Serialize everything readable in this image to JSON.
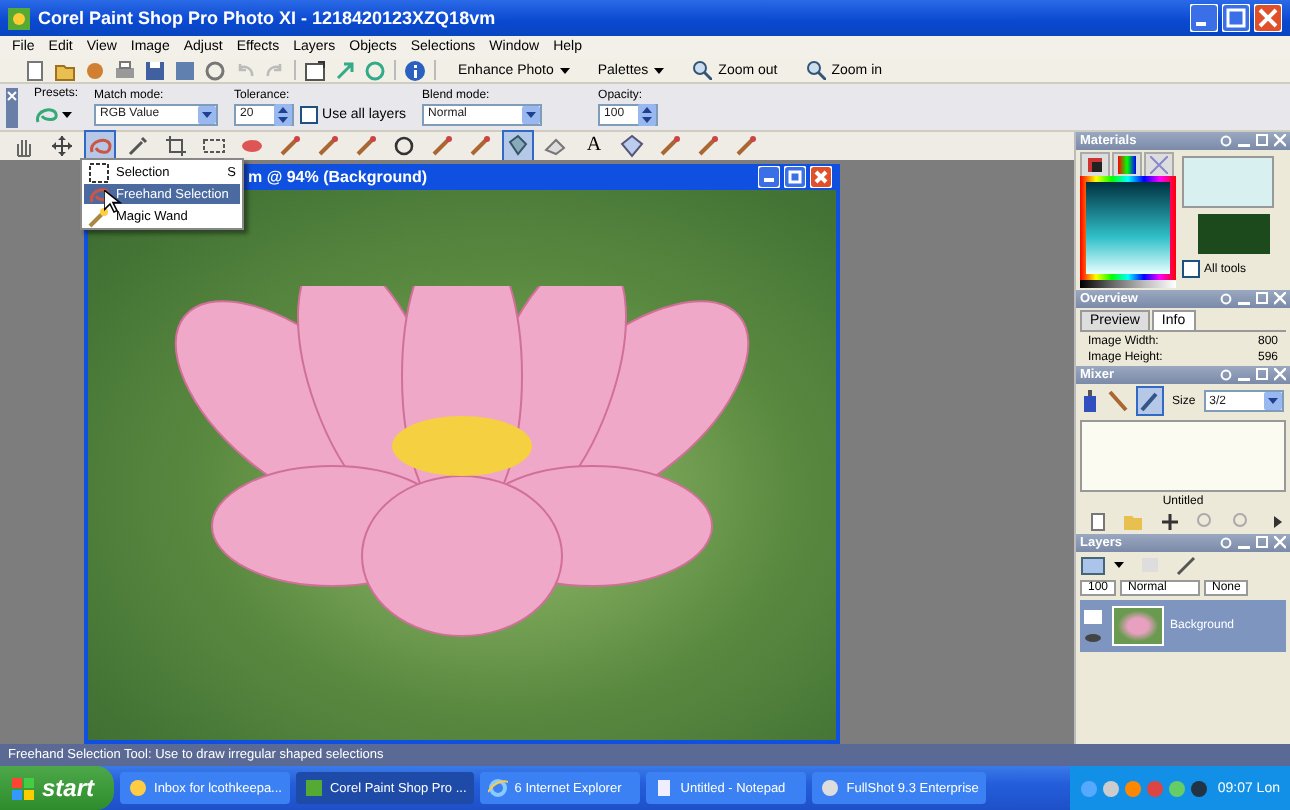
{
  "window": {
    "title": "Corel Paint Shop Pro Photo XI - 1218420123XZQ18vm"
  },
  "menu": [
    "File",
    "Edit",
    "View",
    "Image",
    "Adjust",
    "Effects",
    "Layers",
    "Objects",
    "Selections",
    "Window",
    "Help"
  ],
  "standard_toolbar": [
    {
      "label": "Enhance Photo",
      "kind": "dropdown"
    },
    {
      "label": "Palettes",
      "kind": "dropdown"
    },
    {
      "label": "Zoom out",
      "kind": "zoom"
    },
    {
      "label": "Zoom in",
      "kind": "zoom"
    }
  ],
  "tool_options": {
    "presets_label": "Presets:",
    "match_mode": {
      "label": "Match mode:",
      "value": "RGB Value"
    },
    "tolerance": {
      "label": "Tolerance:",
      "value": "20"
    },
    "use_all_layers": {
      "label": "Use all layers",
      "checked": false
    },
    "blend_mode": {
      "label": "Blend mode:",
      "value": "Normal"
    },
    "opacity": {
      "label": "Opacity:",
      "value": "100"
    }
  },
  "tools": [
    {
      "kind": "pan",
      "selected": false
    },
    {
      "kind": "move",
      "selected": false
    },
    {
      "kind": "selection",
      "selected": true
    },
    {
      "kind": "dropper",
      "selected": false
    },
    {
      "kind": "crop",
      "selected": false
    },
    {
      "kind": "rect",
      "selected": false
    },
    {
      "kind": "eye",
      "selected": false
    },
    {
      "kind": "brush",
      "selected": false
    },
    {
      "kind": "brush",
      "selected": false
    },
    {
      "kind": "brush",
      "selected": false
    },
    {
      "kind": "ellipse",
      "selected": false
    },
    {
      "kind": "brush",
      "selected": false
    },
    {
      "kind": "brush",
      "selected": false
    },
    {
      "kind": "fill",
      "selected": true
    },
    {
      "kind": "eraser",
      "selected": false
    },
    {
      "kind": "text",
      "label": "A",
      "selected": false
    },
    {
      "kind": "shape",
      "selected": false
    },
    {
      "kind": "brush",
      "selected": false
    },
    {
      "kind": "brush",
      "selected": false
    },
    {
      "kind": "brush",
      "selected": false
    }
  ],
  "tool_menu": [
    {
      "label": "Selection",
      "shortcut": "S",
      "selected": false
    },
    {
      "label": "Freehand Selection",
      "selected": true
    },
    {
      "label": "Magic Wand",
      "selected": false
    }
  ],
  "image_window": {
    "title": "m @ 94% (Background)"
  },
  "materials": {
    "title": "Materials",
    "all_tools": {
      "label": "All tools",
      "checked": false
    }
  },
  "overview": {
    "title": "Overview",
    "tabs": [
      {
        "label": "Preview",
        "selected": false
      },
      {
        "label": "Info",
        "selected": true
      }
    ],
    "info": [
      {
        "label": "Image Width:",
        "value": "800"
      },
      {
        "label": "Image Height:",
        "value": "596"
      }
    ]
  },
  "mixer": {
    "title": "Mixer",
    "size_label": "Size",
    "size_value": "3/2",
    "caption": "Untitled"
  },
  "layers": {
    "title": "Layers",
    "opacity": "100",
    "blend": "Normal",
    "mask": "None",
    "items": [
      {
        "name": "Background",
        "selected": true
      }
    ]
  },
  "status_bar": "Freehand Selection Tool: Use to draw irregular shaped selections",
  "taskbar": {
    "start": "start",
    "tasks": [
      {
        "label": "Inbox for lcothkeepa...",
        "selected": false
      },
      {
        "label": "Corel Paint Shop Pro ...",
        "selected": true
      },
      {
        "label": "6 Internet Explorer",
        "selected": false
      },
      {
        "label": "Untitled - Notepad",
        "selected": false
      },
      {
        "label": "FullShot 9.3 Enterprise",
        "selected": false
      }
    ],
    "clock": "09:07 Lon"
  }
}
